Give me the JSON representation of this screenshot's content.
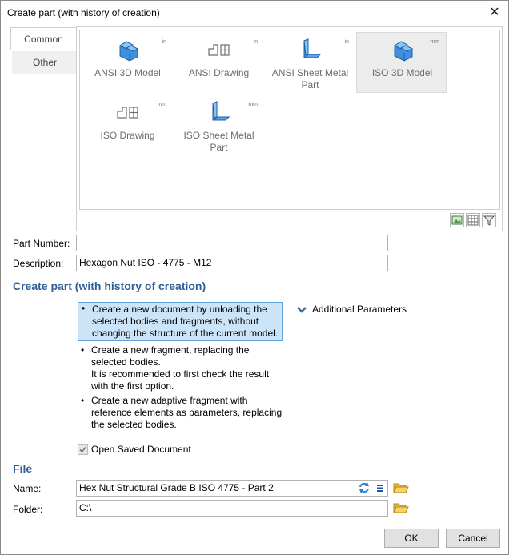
{
  "window": {
    "title": "Create part (with history of creation)"
  },
  "tabs": [
    {
      "label": "Common",
      "active": true
    },
    {
      "label": "Other",
      "active": false
    }
  ],
  "templates": [
    {
      "label": "ANSI 3D Model",
      "unit": "in",
      "icon": "3d-model-icon",
      "selected": false
    },
    {
      "label": "ANSI Drawing",
      "unit": "in",
      "icon": "drawing-icon",
      "selected": false
    },
    {
      "label": "ANSI Sheet Metal Part",
      "unit": "in",
      "icon": "sheet-metal-icon",
      "selected": false
    },
    {
      "label": "ISO 3D Model",
      "unit": "mm",
      "icon": "3d-model-icon",
      "selected": true
    },
    {
      "label": "ISO Drawing",
      "unit": "mm",
      "icon": "drawing-icon",
      "selected": false
    },
    {
      "label": "ISO Sheet Metal Part",
      "unit": "mm",
      "icon": "sheet-metal-icon",
      "selected": false
    }
  ],
  "form": {
    "part_number_label": "Part Number:",
    "part_number_value": "",
    "description_label": "Description:",
    "description_value": "Hexagon Nut ISO - 4775 - M12"
  },
  "create_section": {
    "heading": "Create part (with history of creation)",
    "options": [
      {
        "text": "Create a new document by unloading the selected bodies and fragments, without changing the structure of the current model.",
        "selected": true
      },
      {
        "text": "Create a new fragment, replacing the selected bodies. It is recommended to first check the result with the first option.",
        "selected": false
      },
      {
        "text": "Create a new adaptive fragment with reference elements as parameters, replacing the selected bodies.",
        "selected": false
      }
    ],
    "option_lines": [
      [
        "Create a new document by unloading the",
        "selected bodies and fragments, without",
        "changing the structure of the current model."
      ],
      [
        "Create a new fragment, replacing the",
        "selected bodies.",
        "It is recommended to first check the result",
        "with the first option."
      ],
      [
        "Create a new adaptive fragment with",
        "reference elements as parameters, replacing",
        "the selected bodies."
      ]
    ],
    "additional_parameters": "Additional Parameters",
    "open_saved_label": "Open Saved Document",
    "open_saved_checked": true
  },
  "file": {
    "heading": "File",
    "name_label": "Name:",
    "name_value": "Hex Nut Structural Grade B ISO 4775 - Part 2",
    "folder_label": "Folder:",
    "folder_value": "C:\\"
  },
  "buttons": {
    "ok": "OK",
    "cancel": "Cancel"
  },
  "colors": {
    "accent_heading": "#2f5f96",
    "icon_blue": "#3f8fdd",
    "selection_bg": "#cce4f7"
  }
}
